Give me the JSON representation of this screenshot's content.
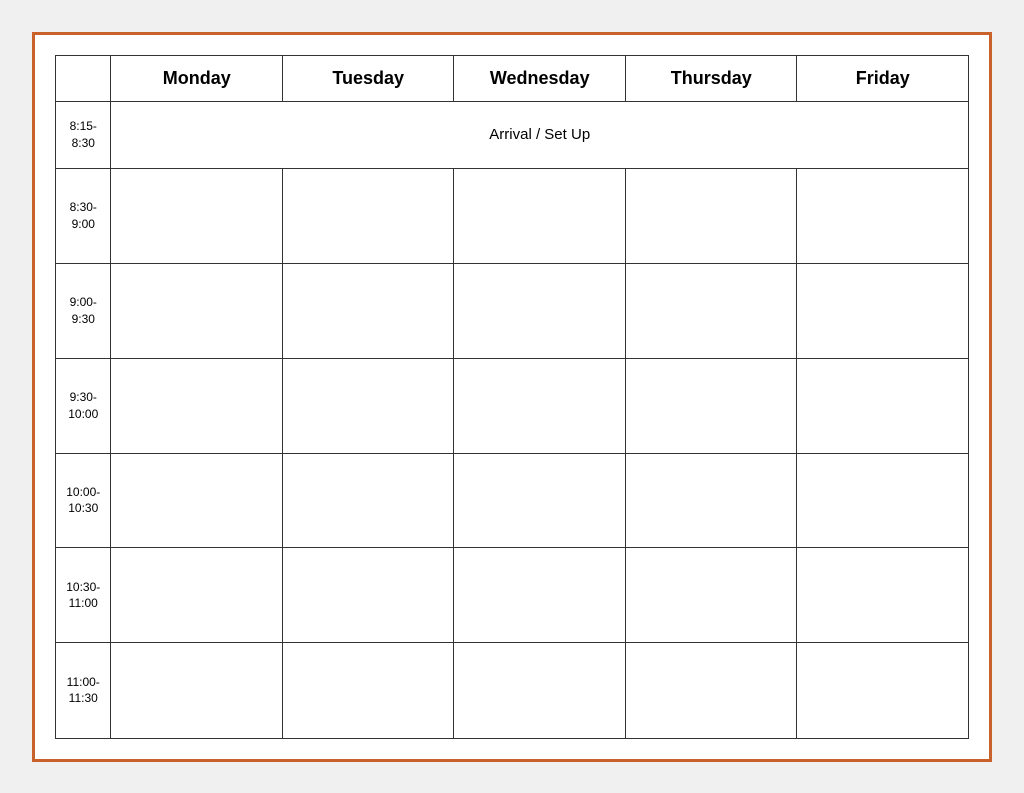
{
  "calendar": {
    "border_color": "#c8622a",
    "headers": {
      "time_col": "",
      "monday": "Monday",
      "tuesday": "Tuesday",
      "wednesday": "Wednesday",
      "thursday": "Thursday",
      "friday": "Friday"
    },
    "rows": [
      {
        "time": "8:15-\n8:30",
        "is_arrival": true,
        "arrival_text": "Arrival / Set Up"
      },
      {
        "time": "8:30-\n9:00",
        "is_arrival": false
      },
      {
        "time": "9:00-\n9:30",
        "is_arrival": false
      },
      {
        "time": "9:30-\n10:00",
        "is_arrival": false
      },
      {
        "time": "10:00-\n10:30",
        "is_arrival": false
      },
      {
        "time": "10:30-\n11:00",
        "is_arrival": false
      },
      {
        "time": "11:00-\n11:30",
        "is_arrival": false
      }
    ]
  }
}
